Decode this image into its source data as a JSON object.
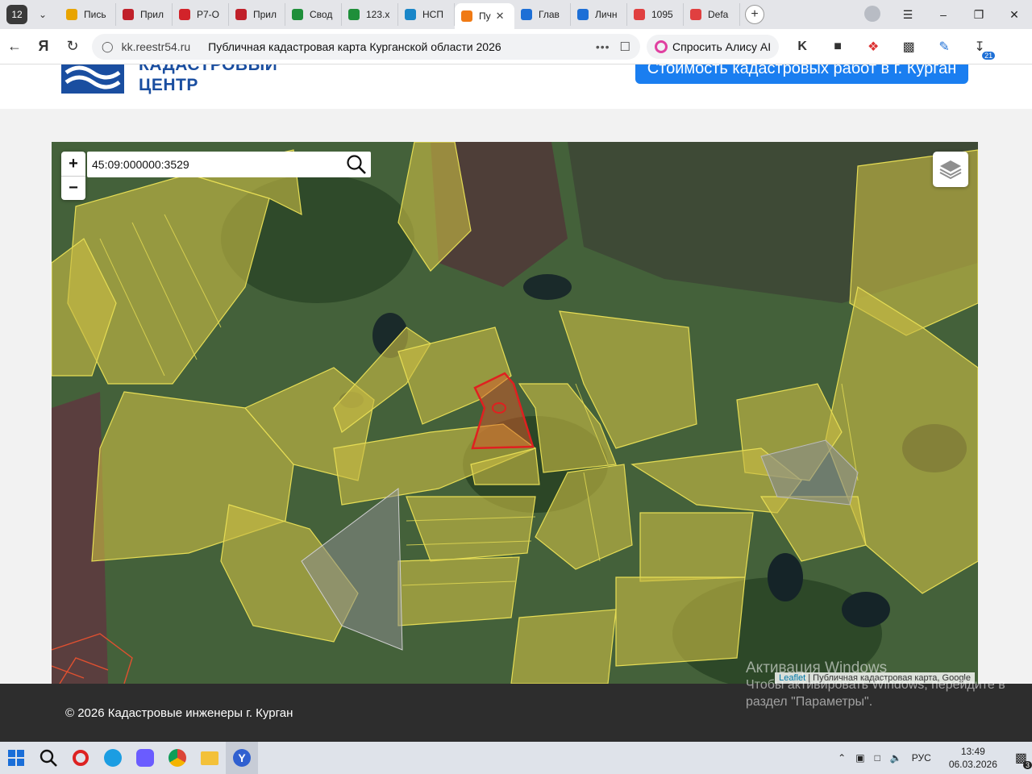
{
  "browser": {
    "tab_count": "12",
    "tabs": [
      {
        "label": "Пись",
        "color": "#e8a400"
      },
      {
        "label": "Прил",
        "color": "#c0202a"
      },
      {
        "label": "Р7-О",
        "color": "#d2232a"
      },
      {
        "label": "Прил",
        "color": "#c0202a"
      },
      {
        "label": "Свод",
        "color": "#1f8f3a"
      },
      {
        "label": "123.х",
        "color": "#1f8f3a"
      },
      {
        "label": "НСП",
        "color": "#1a86c8"
      },
      {
        "label": "Пу",
        "color": "#f07a14",
        "active": true
      },
      {
        "label": "Глав",
        "color": "#1d6fd6"
      },
      {
        "label": "Личн",
        "color": "#1d6fd6"
      },
      {
        "label": "1095",
        "color": "#e04040"
      },
      {
        "label": "Defa",
        "color": "#e04040"
      }
    ],
    "url_domain": "kk.reestr54.ru",
    "page_title": "Публичная кадастровая карта Курганской области 2026",
    "alisa_label": "Спросить Алису AI",
    "downloads_badge": "21"
  },
  "site": {
    "logo_line1": "КАДАСТРОВЫЙ",
    "logo_line2": "ЦЕНТР",
    "cta_label": "Стоимость кадастровых работ в г. Курган",
    "brand_color": "#1a4ea0",
    "cta_color": "#1a7ef0"
  },
  "map": {
    "zoom_in": "+",
    "zoom_out": "−",
    "search_value": "45:09:000000:3529",
    "attribution_link": "Leaflet",
    "attribution_text": "| Публичная кадастровая карта, Google",
    "parcel_highlight_color": "#e02020",
    "parcel_fill_color": "#d4c040"
  },
  "footer": {
    "copyright": "© 2026 Кадастровые инженеры г. Курган"
  },
  "windows": {
    "watermark_line1": "Активация Windows",
    "watermark_line2": "Чтобы активировать Windows, перейдите в",
    "watermark_line3": "раздел \"Параметры\".",
    "lang": "РУС",
    "time": "13:49",
    "date": "06.03.2026",
    "notifications": "3"
  }
}
